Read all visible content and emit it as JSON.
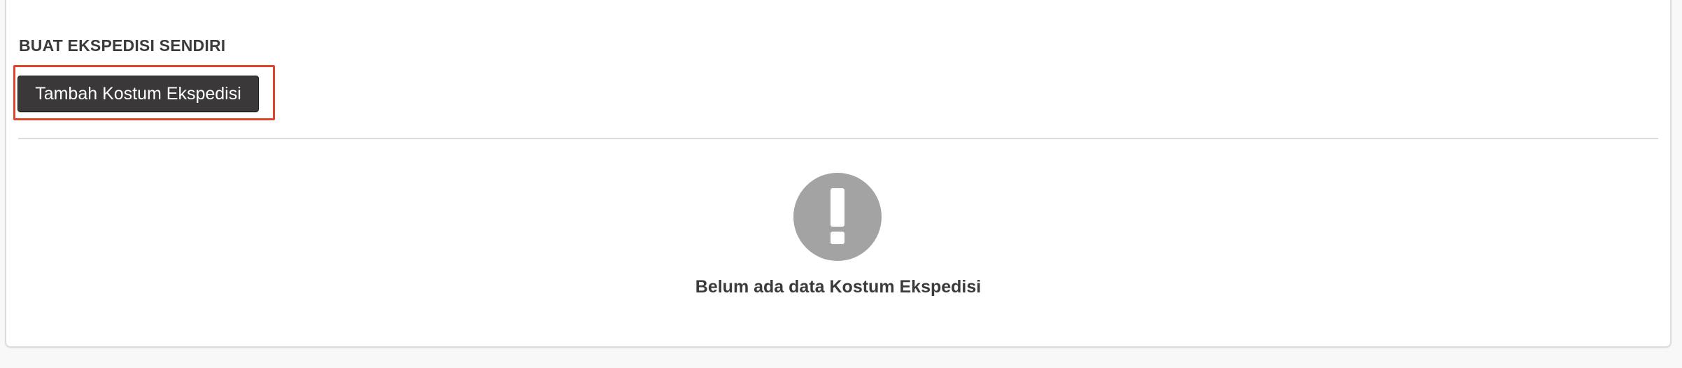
{
  "section": {
    "title": "BUAT EKSPEDISI SENDIRI",
    "add_button_label": "Tambah Kostum Ekspedisi",
    "highlight_color": "#e0432b"
  },
  "empty_state": {
    "icon": "exclamation-circle-icon",
    "message": "Belum ada data Kostum Ekspedisi"
  }
}
